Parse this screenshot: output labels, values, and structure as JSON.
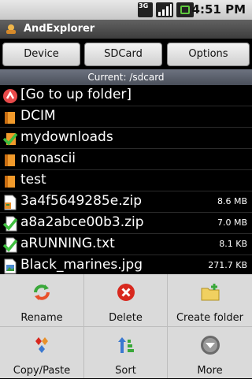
{
  "status": {
    "time": "4:51 PM",
    "network": "3G",
    "accent": "#5ec83e"
  },
  "app": {
    "title": "AndExplorer"
  },
  "toolbar": {
    "device_label": "Device",
    "sdcard_label": "SDCard",
    "options_label": "Options"
  },
  "current_path": "Current: /sdcard",
  "files": [
    {
      "name": "[Go to up folder]",
      "size": "",
      "icon": "up-folder-icon"
    },
    {
      "name": "DCIM",
      "size": "",
      "icon": "folder-icon"
    },
    {
      "name": "mydownloads",
      "size": "",
      "icon": "checked-folder-icon"
    },
    {
      "name": "nonascii",
      "size": "",
      "icon": "folder-icon"
    },
    {
      "name": "test",
      "size": "",
      "icon": "folder-icon"
    },
    {
      "name": "3a4f5649285e.zip",
      "size": "8.6 MB",
      "icon": "zip-file-icon"
    },
    {
      "name": "a8a2abce00b3.zip",
      "size": "7.0 MB",
      "icon": "checked-zip-file-icon"
    },
    {
      "name": "aRUNNING.txt",
      "size": "8.1 KB",
      "icon": "checked-text-file-icon"
    },
    {
      "name": "Black_marines.jpg",
      "size": "271.7 KB",
      "icon": "image-file-icon"
    }
  ],
  "menu": {
    "rename_label": "Rename",
    "delete_label": "Delete",
    "create_folder_label": "Create folder",
    "copy_paste_label": "Copy/Paste",
    "sort_label": "Sort",
    "more_label": "More"
  }
}
